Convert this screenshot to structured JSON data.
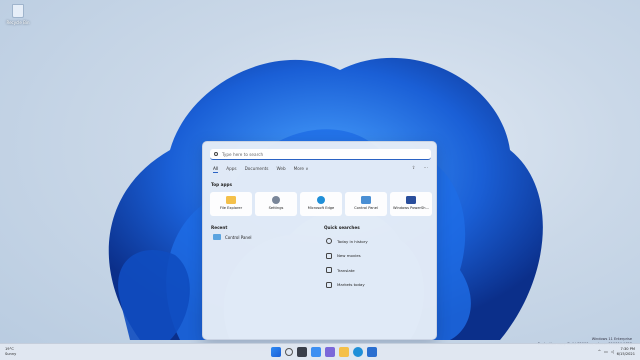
{
  "desktop": {
    "recycle_bin_label": "Recycle Bin"
  },
  "start_menu": {
    "search_placeholder": "Type here to search",
    "tabs": [
      "All",
      "Apps",
      "Documents",
      "Web",
      "More ∨"
    ],
    "top_apps_title": "Top apps",
    "top_apps": [
      {
        "label": "File Explorer",
        "icon": "folder-icon",
        "color": "#f4c04a"
      },
      {
        "label": "Settings",
        "icon": "gear-icon",
        "color": "#7a8699"
      },
      {
        "label": "Microsoft Edge",
        "icon": "edge-icon",
        "color": "#1f8fd8"
      },
      {
        "label": "Control Panel",
        "icon": "control-panel-icon",
        "color": "#4a8fd4"
      },
      {
        "label": "Windows PowerSh...",
        "icon": "powershell-icon",
        "color": "#2a4e9c"
      }
    ],
    "recent_title": "Recent",
    "recent": [
      {
        "label": "Control Panel",
        "icon": "control-panel-icon"
      }
    ],
    "quick_searches_title": "Quick searches",
    "quick_searches": [
      {
        "label": "Today in history",
        "icon": "clock-icon"
      },
      {
        "label": "New movies",
        "icon": "film-icon"
      },
      {
        "label": "Translate",
        "icon": "translate-icon"
      },
      {
        "label": "Markets today",
        "icon": "chart-icon"
      }
    ]
  },
  "watermark": {
    "line1": "Windows 11 Enterprise",
    "line2": "Evaluation copy. Build 22000.rs_release.210604-1628"
  },
  "taskbar": {
    "weather_temp": "19°C",
    "weather_desc": "Sunny",
    "time": "7:30 PM",
    "date": "6/15/2021",
    "icons": [
      "windows-start-icon",
      "search-icon",
      "task-view-icon",
      "widgets-icon",
      "chat-icon",
      "file-explorer-icon",
      "edge-icon",
      "store-icon"
    ]
  }
}
